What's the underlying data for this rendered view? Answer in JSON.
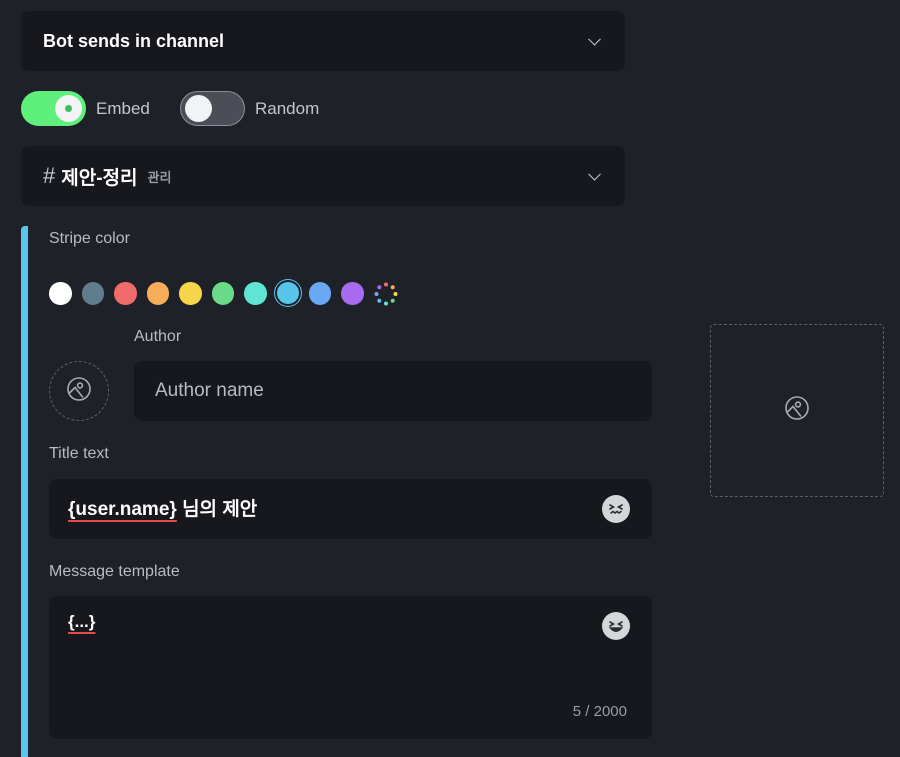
{
  "mode_select": {
    "label": "Bot sends in channel"
  },
  "toggles": {
    "embed": {
      "label": "Embed",
      "on": true
    },
    "random": {
      "label": "Random",
      "on": false
    }
  },
  "channel_select": {
    "hash": "#",
    "name": "제안-정리",
    "tag": "관리"
  },
  "stripe": {
    "label": "Stripe color",
    "selected_color": "#58c6ea",
    "swatches": [
      "#ffffff",
      "#5f7d8c",
      "#f26b6b",
      "#f7ac5a",
      "#f7d54a",
      "#6bd98a",
      "#5fe5d2",
      "#58c6ea",
      "#6aa8f5",
      "#a86bf0"
    ],
    "custom_color_icon": "color-wheel-icon"
  },
  "author": {
    "label": "Author",
    "placeholder": "Author name",
    "avatar_icon": "image-icon"
  },
  "thumbnail": {
    "icon": "image-icon"
  },
  "title": {
    "label": "Title text",
    "variable": "{user.name}",
    "rest": " 님의 제안",
    "emoji_icon": "emoji-picker-icon"
  },
  "message": {
    "label": "Message template",
    "value": "{...}",
    "counter": "5 / 2000",
    "emoji_icon": "emoji-picker-icon"
  }
}
